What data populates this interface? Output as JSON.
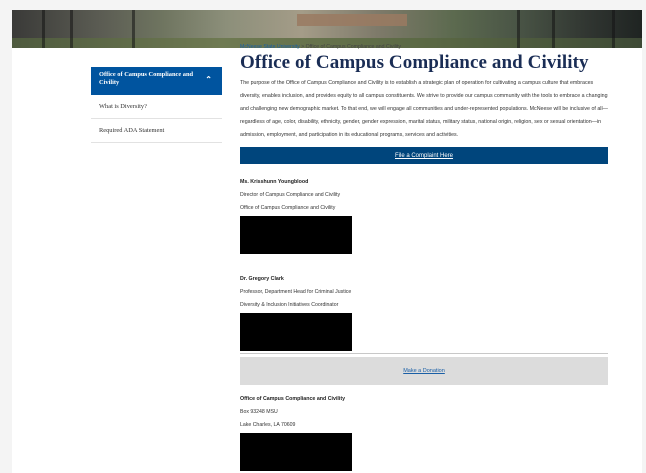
{
  "sidebar": {
    "active": "Office of Campus Compliance and Civility",
    "items": [
      {
        "label": "What is Diversity?"
      },
      {
        "label": "Required ADA Statement"
      }
    ]
  },
  "breadcrumb": {
    "root": "McNeese State University",
    "separator": ">",
    "current": "Office of Campus Compliance and Civility"
  },
  "page": {
    "title": "Office of Campus Compliance and Civility",
    "intro": "The purpose of the Office of Campus Compliance and Civility is to establish a strategic plan of operation for cultivating a campus culture that embraces diversity, enables inclusion, and provides equity to all campus constituents. We strive to provide our campus community with the tools to embrace a changing and challenging new demographic market. To that end, we will engage all communities and under-represented populations. McNeese will be inclusive of all—regardless of age, color, disability, ethnicity, gender, gender expression, marital status, military status, national origin, religion, sex or sexual orientation—in admission, employment, and participation in its educational programs, services and activities.",
    "complaint_label": "File a Complaint Here",
    "donation_label": "Make a Donation"
  },
  "contacts": [
    {
      "name": "Ms. Krisshunn Youngblood",
      "line1": "Director of Campus Compliance and Civility",
      "line2": "Office of Campus Compliance and Civility"
    },
    {
      "name": "Dr. Gregory Clark",
      "line1": "Professor, Department Head for Criminal Justice",
      "line2": "Diversity & Inclusion Initiatives Coordinator"
    }
  ],
  "office": {
    "name": "Office of Campus Compliance and Civility",
    "line1": "Box 93248 MSU",
    "line2": "Lake Charles, LA 70609"
  },
  "colors": {
    "brand_blue": "#00549f",
    "button_navy": "#00457c",
    "title_navy": "#1a2d55"
  }
}
